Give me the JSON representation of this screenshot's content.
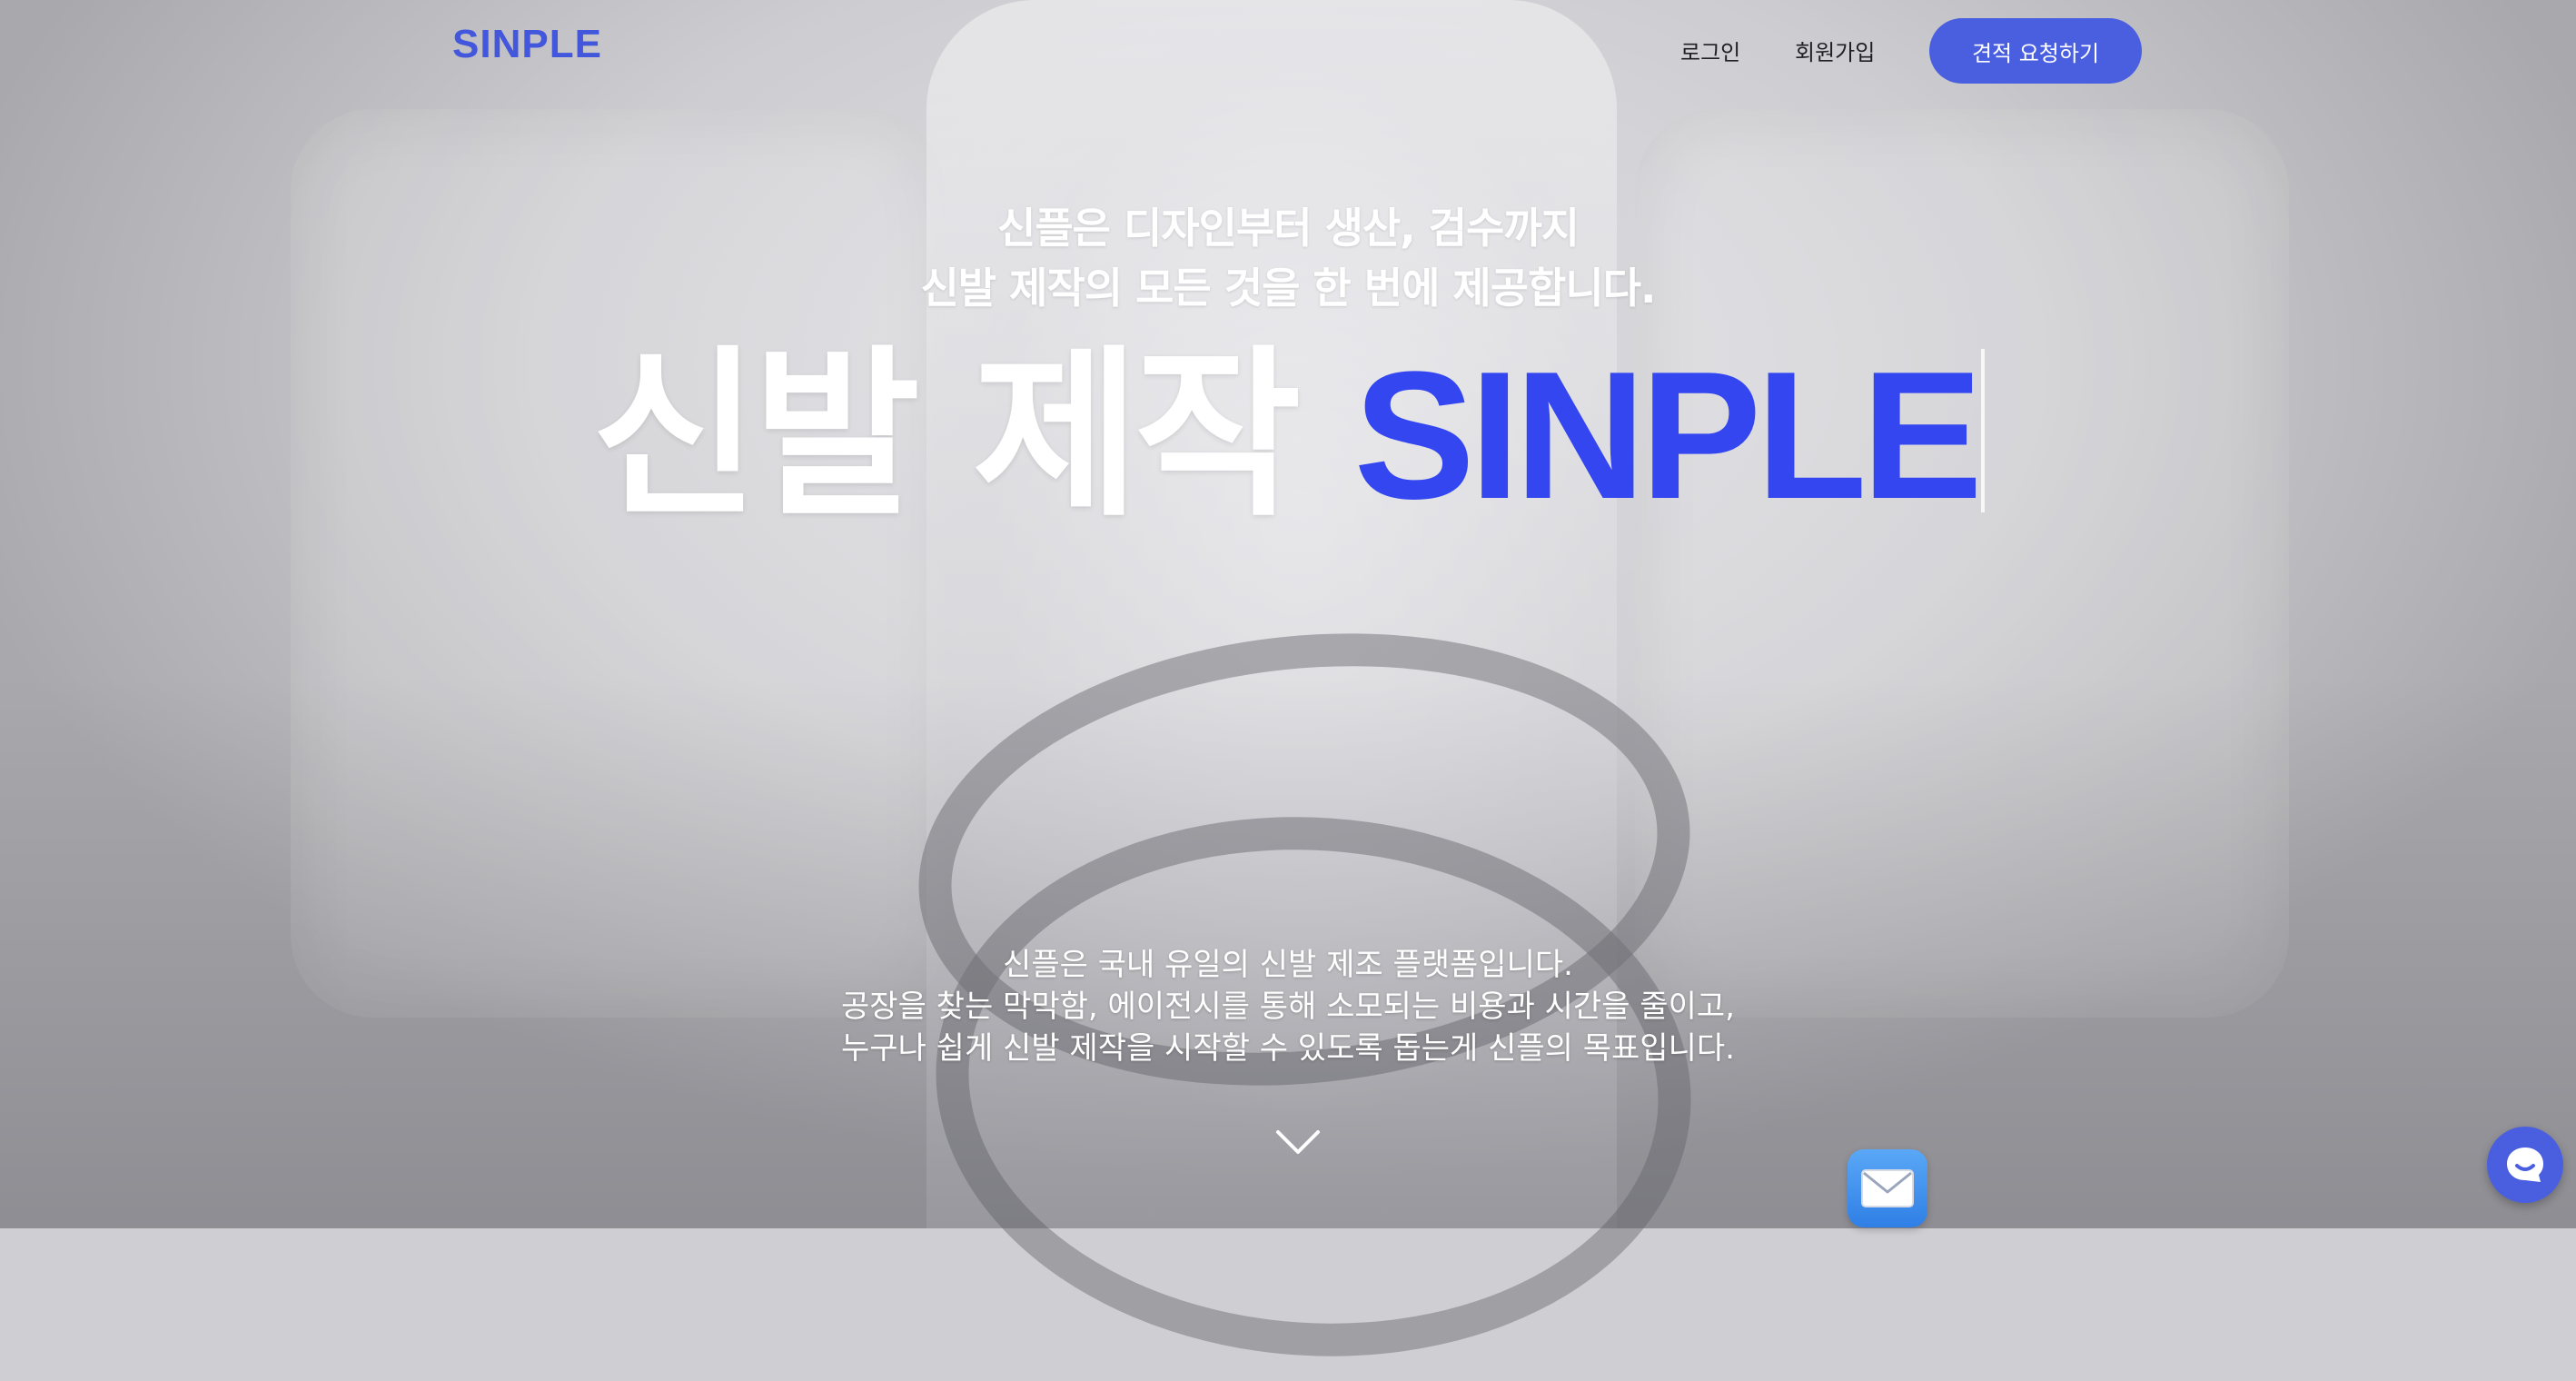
{
  "header": {
    "logo": "SINPLE",
    "nav": {
      "login": "로그인",
      "signup": "회원가입"
    },
    "cta": "견적 요청하기"
  },
  "hero": {
    "subhead_line1": "신플은 디자인부터 생산, 검수까지",
    "subhead_line2": "신발 제작의 모든 것을 한 번에 제공합니다.",
    "headline_korean": "신발 제작",
    "headline_brand": "SINPLE",
    "description": [
      "신플은 국내 유일의 신발 제조 플랫폼입니다.",
      "공장을 찾는 막막함, 에이전시를 통해 소모되는 비용과 시간을 줄이고,",
      "누구나 쉽게 신발 제작을 시작할 수 있도록 돕는게 신플의 목표입니다."
    ]
  },
  "icons": {
    "scroll": "chevron-down-icon",
    "mail": "mail-icon",
    "chat": "chat-icon"
  },
  "colors": {
    "brand": "#4357DC",
    "headline_brand": "#3346F0",
    "cta_bg": "#4A5FE0",
    "text_light": "#FFFFFF"
  }
}
